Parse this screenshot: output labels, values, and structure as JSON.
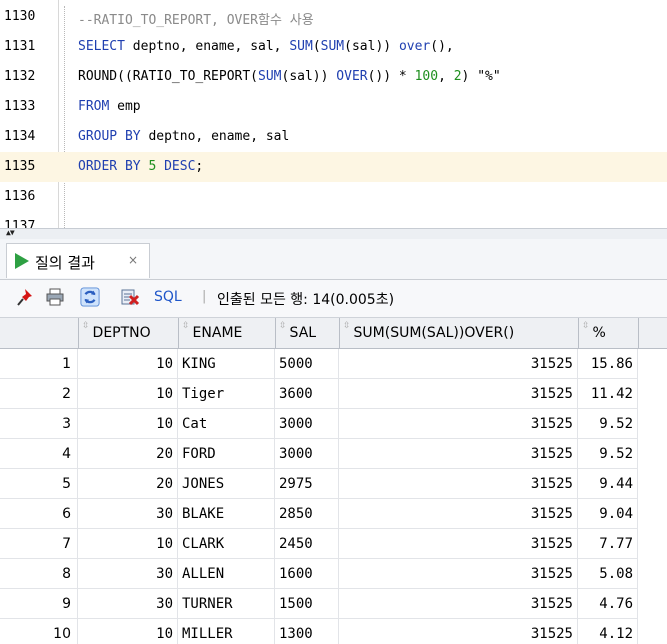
{
  "editor": {
    "lines": [
      {
        "num": "1130",
        "segments": [
          {
            "t": "--RATIO_TO_REPORT, OVER함수 사용",
            "c": "cm"
          }
        ]
      },
      {
        "num": "1131",
        "segments": [
          {
            "t": "SELECT",
            "c": "kw"
          },
          {
            "t": " deptno, ename, sal, ",
            "c": ""
          },
          {
            "t": "SUM",
            "c": "kw"
          },
          {
            "t": "(",
            "c": ""
          },
          {
            "t": "SUM",
            "c": "kw"
          },
          {
            "t": "(sal)) ",
            "c": ""
          },
          {
            "t": "over",
            "c": "kw"
          },
          {
            "t": "(),",
            "c": ""
          }
        ]
      },
      {
        "num": "1132",
        "segments": [
          {
            "t": "ROUND((RATIO_TO_REPORT(",
            "c": ""
          },
          {
            "t": "SUM",
            "c": "kw"
          },
          {
            "t": "(sal)) ",
            "c": ""
          },
          {
            "t": "OVER",
            "c": "kw"
          },
          {
            "t": "()) * ",
            "c": ""
          },
          {
            "t": "100",
            "c": "num"
          },
          {
            "t": ", ",
            "c": ""
          },
          {
            "t": "2",
            "c": "num"
          },
          {
            "t": ") \"%\"",
            "c": ""
          }
        ]
      },
      {
        "num": "1133",
        "segments": [
          {
            "t": "FROM",
            "c": "kw"
          },
          {
            "t": " emp",
            "c": ""
          }
        ]
      },
      {
        "num": "1134",
        "segments": [
          {
            "t": "GROUP BY",
            "c": "kw"
          },
          {
            "t": " deptno, ename, sal",
            "c": ""
          }
        ]
      },
      {
        "num": "1135",
        "segments": [
          {
            "t": "ORDER BY",
            "c": "kw"
          },
          {
            "t": " ",
            "c": ""
          },
          {
            "t": "5",
            "c": "num"
          },
          {
            "t": " ",
            "c": ""
          },
          {
            "t": "DESC",
            "c": "kw"
          },
          {
            "t": ";",
            "c": ""
          }
        ],
        "current": true
      },
      {
        "num": "1136",
        "segments": []
      },
      {
        "num": "1137",
        "segments": []
      }
    ]
  },
  "results_tab": {
    "label": "질의 결과",
    "close": "×"
  },
  "toolbar": {
    "sql_label": "SQL",
    "separator": "|",
    "status": "인출된 모든 행: 14(0.005초)"
  },
  "grid": {
    "columns": [
      "DEPTNO",
      "ENAME",
      "SAL",
      "SUM(SUM(SAL))OVER()",
      "%"
    ],
    "rows": [
      {
        "n": "1",
        "deptno": "10",
        "ename": "KING",
        "sal": "5000",
        "sum": "31525",
        "pct": "15.86"
      },
      {
        "n": "2",
        "deptno": "10",
        "ename": "Tiger",
        "sal": "3600",
        "sum": "31525",
        "pct": "11.42"
      },
      {
        "n": "3",
        "deptno": "10",
        "ename": "Cat",
        "sal": "3000",
        "sum": "31525",
        "pct": "9.52"
      },
      {
        "n": "4",
        "deptno": "20",
        "ename": "FORD",
        "sal": "3000",
        "sum": "31525",
        "pct": "9.52"
      },
      {
        "n": "5",
        "deptno": "20",
        "ename": "JONES",
        "sal": "2975",
        "sum": "31525",
        "pct": "9.44"
      },
      {
        "n": "6",
        "deptno": "30",
        "ename": "BLAKE",
        "sal": "2850",
        "sum": "31525",
        "pct": "9.04"
      },
      {
        "n": "7",
        "deptno": "10",
        "ename": "CLARK",
        "sal": "2450",
        "sum": "31525",
        "pct": "7.77"
      },
      {
        "n": "8",
        "deptno": "30",
        "ename": "ALLEN",
        "sal": "1600",
        "sum": "31525",
        "pct": "5.08"
      },
      {
        "n": "9",
        "deptno": "30",
        "ename": "TURNER",
        "sal": "1500",
        "sum": "31525",
        "pct": "4.76"
      },
      {
        "n": "10",
        "deptno": "10",
        "ename": "MILLER",
        "sal": "1300",
        "sum": "31525",
        "pct": "4.12"
      }
    ]
  },
  "icons": {
    "pin": "pin-icon",
    "print": "printer-icon",
    "refresh": "refresh-icon",
    "export": "export-icon",
    "run": "play-icon"
  },
  "colors": {
    "keyword": "#1f3fb0",
    "comment": "#8a8a8a",
    "number": "#1f8f1f",
    "current_line": "#fdf6e3",
    "sql_link": "#1f56c9",
    "play": "#2ea043"
  }
}
